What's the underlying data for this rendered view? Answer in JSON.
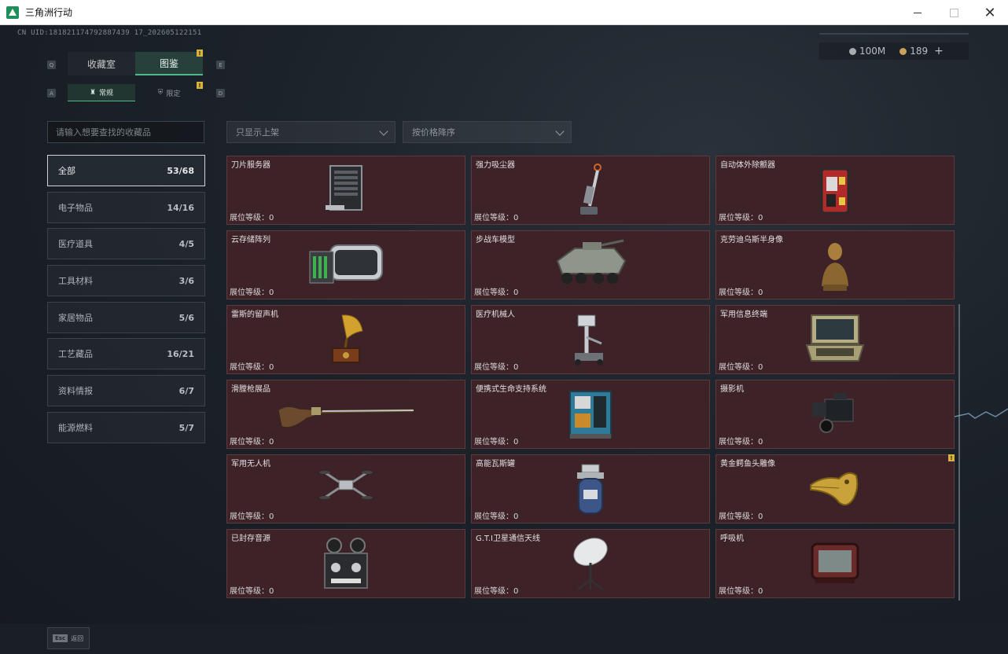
{
  "window": {
    "title": "三角洲行动"
  },
  "header": {
    "uid": "CN UID:181821174792887439 17_202605122151",
    "currency_silver": "100M",
    "currency_gold": "189",
    "plus": "+"
  },
  "tabs": [
    {
      "label": "收藏室",
      "active": false
    },
    {
      "label": "图鉴",
      "active": true
    }
  ],
  "tab_keys": {
    "left": "Q",
    "right": "E"
  },
  "subtabs": [
    {
      "label": "常规",
      "active": true
    },
    {
      "label": "限定",
      "active": false
    }
  ],
  "subtab_keys": {
    "left": "A",
    "right": "D"
  },
  "alert_mark": "!",
  "search": {
    "placeholder": "请输入想要查找的收藏品"
  },
  "filters": {
    "listing": "只显示上架",
    "sort": "按价格降序"
  },
  "categories": [
    {
      "label": "全部",
      "count": "53/68",
      "active": true
    },
    {
      "label": "电子物品",
      "count": "14/16"
    },
    {
      "label": "医疗道具",
      "count": "4/5"
    },
    {
      "label": "工具材料",
      "count": "3/6"
    },
    {
      "label": "家居物品",
      "count": "5/6"
    },
    {
      "label": "工艺藏品",
      "count": "16/21"
    },
    {
      "label": "资料情报",
      "count": "6/7"
    },
    {
      "label": "能源燃料",
      "count": "5/7"
    }
  ],
  "level_label": "展位等级：0",
  "items": [
    {
      "name": "刀片服务器",
      "icon": "blade-server-icon"
    },
    {
      "name": "强力吸尘器",
      "icon": "vacuum-cleaner-icon"
    },
    {
      "name": "自动体外除颤器",
      "icon": "defibrillator-icon"
    },
    {
      "name": "云存储阵列",
      "icon": "storage-array-icon"
    },
    {
      "name": "步战车模型",
      "icon": "ifv-model-icon"
    },
    {
      "name": "克劳迪乌斯半身像",
      "icon": "bust-icon"
    },
    {
      "name": "雷斯的留声机",
      "icon": "gramophone-icon"
    },
    {
      "name": "医疗机械人",
      "icon": "medical-robot-icon"
    },
    {
      "name": "军用信息终端",
      "icon": "military-terminal-icon"
    },
    {
      "name": "滑膛枪展品",
      "icon": "musket-icon"
    },
    {
      "name": "便携式生命支持系统",
      "icon": "life-support-icon"
    },
    {
      "name": "摄影机",
      "icon": "camera-icon"
    },
    {
      "name": "军用无人机",
      "icon": "drone-icon"
    },
    {
      "name": "高能瓦斯罐",
      "icon": "gas-canister-icon"
    },
    {
      "name": "黄金鳄鱼头雕像",
      "icon": "gold-crocodile-icon",
      "alert": true
    },
    {
      "name": "已封存音源",
      "icon": "reel-recorder-icon"
    },
    {
      "name": "G.T.I卫星通信天线",
      "icon": "satellite-dish-icon"
    },
    {
      "name": "呼吸机",
      "icon": "ventilator-icon"
    }
  ],
  "footer": {
    "esc_key": "Esc",
    "back_label": "返回"
  }
}
